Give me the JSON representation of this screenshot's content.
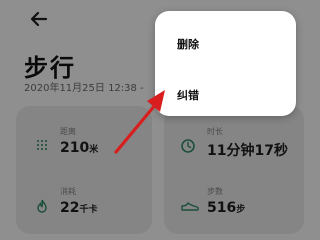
{
  "header": {
    "title": "步行",
    "date": "2020年11月25日 12:38 -"
  },
  "metrics": {
    "distance": {
      "label": "距离",
      "value": "210",
      "unit": "米"
    },
    "duration": {
      "label": "时长",
      "value": "11分钟17秒"
    },
    "calories": {
      "label": "消耗",
      "value": "22",
      "unit": "千卡"
    },
    "steps": {
      "label": "步数",
      "value": "516",
      "unit": "步"
    }
  },
  "menu": {
    "delete": "删除",
    "correct": "纠错"
  },
  "colors": {
    "accent": "#27a66b",
    "arrow": "#e02020",
    "icon_dark": "#1c4f3a"
  }
}
